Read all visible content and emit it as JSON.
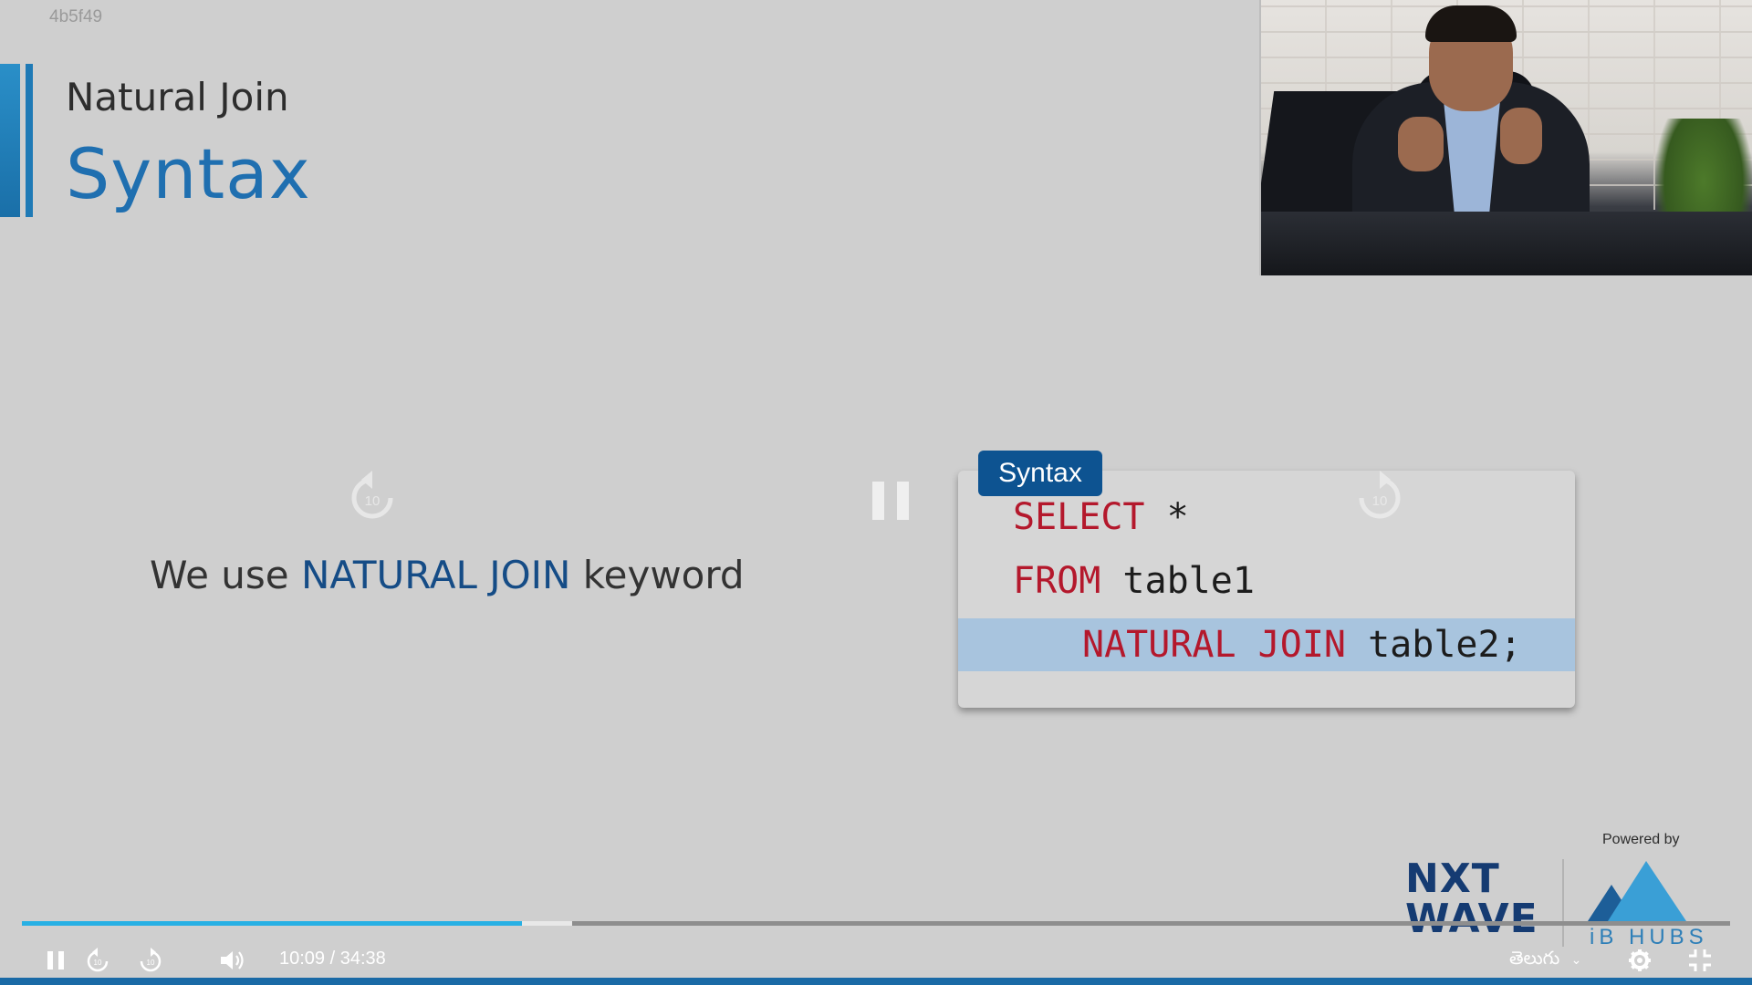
{
  "video_id": "4b5f49",
  "slide": {
    "subtitle": "Natural Join",
    "title": "Syntax",
    "body_prefix": "We use ",
    "body_keyword": "NATURAL JOIN",
    "body_suffix": " keyword"
  },
  "code_card": {
    "tag": "Syntax",
    "lines": [
      {
        "keyword": "SELECT",
        "rest": " *"
      },
      {
        "keyword": "FROM",
        "rest": " table1"
      },
      {
        "keyword": "NATURAL JOIN",
        "rest": " table2;"
      }
    ]
  },
  "overlay": {
    "seek_back_label": "10",
    "seek_forward_label": "10"
  },
  "brand": {
    "powered_by": "Powered by",
    "nxt_line1": "NXT",
    "nxt_line2": "WAVE",
    "ibhubs": "iB HUBS"
  },
  "player": {
    "current_time": "10:09",
    "separator": "/",
    "duration": "34:38",
    "progress_fraction": 0.293,
    "buffered_fraction": 0.322,
    "language": "తెలుగు",
    "seek_back_label": "10",
    "seek_forward_label": "10"
  },
  "colors": {
    "accent_blue": "#1f6fb0",
    "keyword_red": "#b4182c",
    "progress_played": "#27b0e4",
    "tag_blue": "#0d5391"
  }
}
